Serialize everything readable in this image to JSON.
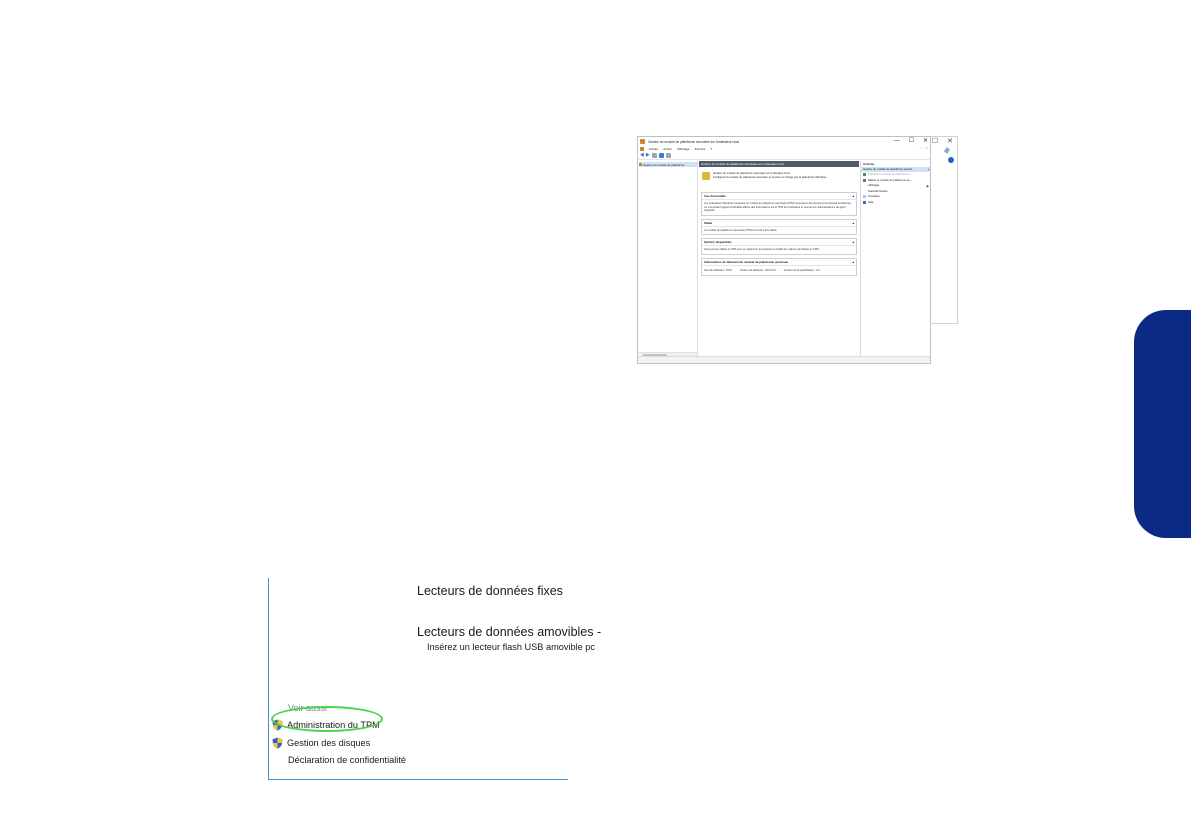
{
  "mmc_window": {
    "title": "Gestion du module de plateforme sécurisée sur l'ordinateur local",
    "window_buttons": [
      "—",
      "☐",
      "✕"
    ],
    "background_window_buttons": [
      "☐",
      "✕"
    ],
    "menu": [
      "Fichier",
      "Action",
      "Affichage",
      "Fenêtre",
      "?"
    ],
    "mdi_buttons": [
      "–",
      "▫",
      "×"
    ],
    "tree_item": "Gestion du module de plateforme",
    "center_header": "Gestion du module de plateforme sécurisée sur l'ordinateur local",
    "intro_line1": "Gestion du module de plateforme sécurisée sur l'ordinateur local",
    "intro_line2": "Configurez le module de plateforme sécurisée et sa prise en charge par la plateforme Windows.",
    "sections": {
      "overview_title": "Vue d'ensemble",
      "overview_text": "Les ordinateurs Windows contenant un module de plateforme sécurisée (TPM) fournissent des fonctions de sécurité améliorées. Ce composant logiciel enfichable affiche des informations sur le TPM de l'ordinateur et permet aux administrateurs de gérer l'appareil.",
      "status_title": "Statut",
      "status_text": "Le module de plateforme sécurisée (TPM) est prêt à être utilisé.",
      "options_title": "Options disponibles",
      "options_text": "Vous pouvez effacer le TPM pour en supprimer la propriété et rétablir les valeurs par défaut du TPM.",
      "manufacturer_title": "Informations du fabricant du module de plateforme sécurisée",
      "manufacturer_name": "Nom du fabricant : INTC",
      "manufacturer_version": "Version du fabricant : 403.0.0.0",
      "spec_version": "Version de la spécification : 2.0"
    },
    "actions": {
      "title": "Actions",
      "subheader": "Gestion du module de plateforme sécuris...",
      "items": [
        "Préparer le module de plateforme s...",
        "Effacer le module de plateforme sé...",
        "Affichage",
        "Nouvelle fenêtre",
        "Actualiser",
        "Aide"
      ]
    }
  },
  "bitlocker_panel": {
    "fixed_drives": "Lecteurs de données fixes",
    "removable_drives": "Lecteurs de données amovibles -",
    "removable_hint": "Insérez un lecteur flash USB amovible pc",
    "see_also": "Voir aussi",
    "links": [
      "Administration du TPM",
      "Gestion des disques",
      "Déclaration de confidentialité"
    ]
  },
  "colors": {
    "highlight_ring": "#4bd64a",
    "side_tab": "#0a2a86",
    "panel_border": "#3c8fd8"
  }
}
